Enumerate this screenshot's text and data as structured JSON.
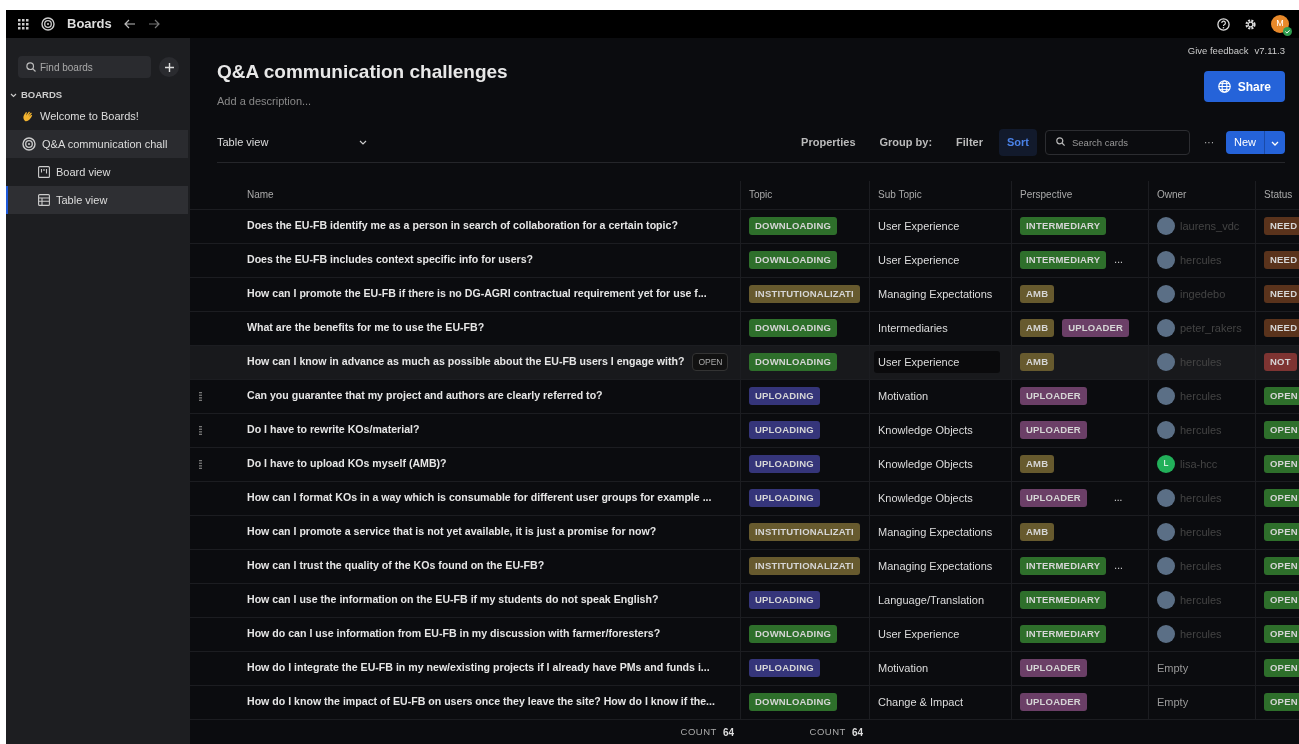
{
  "topbar": {
    "title": "Boards",
    "user_initial": "M"
  },
  "sidebar": {
    "search": {
      "placeholder": "Find boards"
    },
    "section": "BOARDS",
    "items": [
      {
        "label": "Welcome to Boards!",
        "selected": false
      },
      {
        "label": "Q&A communication chall",
        "selected": false,
        "children": [
          {
            "label": "Board view",
            "selected": false
          },
          {
            "label": "Table view",
            "selected": true
          }
        ]
      }
    ]
  },
  "header": {
    "feedback": "Give feedback",
    "version": "v7.11.3",
    "title": "Q&A communication challenges",
    "description_placeholder": "Add a description...",
    "share": "Share"
  },
  "toolbar": {
    "view": "Table view",
    "buttons": [
      {
        "label": "Properties",
        "active": false
      },
      {
        "label": "Group by:",
        "active": false
      },
      {
        "label": "Filter",
        "active": false
      },
      {
        "label": "Sort",
        "active": true
      }
    ],
    "search": {
      "placeholder": "Search cards"
    },
    "more": "···",
    "new": "New"
  },
  "table": {
    "columns": [
      "Name",
      "Topic",
      "Sub Topic",
      "Perspective",
      "Owner",
      "Status"
    ],
    "rows": [
      {
        "name": "Does the EU-FB identify me as a person in search of collaboration for a certain topic?",
        "hovered": false,
        "drag_handle": false,
        "topic": {
          "label": "DOWNLOADING",
          "color": "#2e6f2b"
        },
        "sub_topic": "User Experience",
        "perspective": [
          {
            "label": "INTERMEDIARY",
            "color": "#2e6f2b"
          }
        ],
        "owner": {
          "name": "laurens_vdc",
          "kind": "photo"
        },
        "status": {
          "label": "NEED",
          "color": "#5a331c"
        }
      },
      {
        "name": "Does the EU-FB includes context specific info for users?",
        "hovered": false,
        "drag_handle": false,
        "topic": {
          "label": "DOWNLOADING",
          "color": "#2e6f2b"
        },
        "sub_topic": "User Experience",
        "perspective": [
          {
            "label": "INTERMEDIARY",
            "color": "#2e6f2b"
          }
        ],
        "perspective_more": "...",
        "owner": {
          "name": "hercules",
          "kind": "photo"
        },
        "status": {
          "label": "NEED",
          "color": "#5a331c"
        }
      },
      {
        "name": "How can I promote the EU-FB if there is no DG-AGRI contractual requirement yet for use f...",
        "hovered": false,
        "drag_handle": false,
        "topic": {
          "label": "INSTITUTIONALIZATI",
          "color": "#675a2e"
        },
        "sub_topic": "Managing Expectations",
        "perspective": [
          {
            "label": "AMB",
            "color": "#675a2e"
          }
        ],
        "owner": {
          "name": "ingedebo",
          "kind": "photo"
        },
        "status": {
          "label": "NEED",
          "color": "#5a331c"
        }
      },
      {
        "name": "What are the benefits for me to use the EU-FB?",
        "hovered": false,
        "drag_handle": false,
        "topic": {
          "label": "DOWNLOADING",
          "color": "#2e6f2b"
        },
        "sub_topic": "Intermediaries",
        "perspective": [
          {
            "label": "AMB",
            "color": "#675a2e"
          },
          {
            "label": "UPLOADER",
            "color": "#6b3f67"
          }
        ],
        "owner": {
          "name": "peter_rakers",
          "kind": "photo"
        },
        "status": {
          "label": "NEED",
          "color": "#5a331c"
        }
      },
      {
        "name": "How can I know in advance as much as possible about the EU-FB users I engage with?",
        "hovered": true,
        "open_button": "OPEN",
        "drag_handle": false,
        "topic": {
          "label": "DOWNLOADING",
          "color": "#2e6f2b"
        },
        "sub_topic": "User Experience",
        "perspective": [
          {
            "label": "AMB",
            "color": "#675a2e"
          }
        ],
        "owner": {
          "name": "hercules",
          "kind": "photo"
        },
        "status": {
          "label": "NOT",
          "color": "#7e3432"
        }
      },
      {
        "name": "Can you guarantee that my project and authors are clearly referred to?",
        "hovered": false,
        "drag_handle": true,
        "topic": {
          "label": "UPLOADING",
          "color": "#35357a"
        },
        "sub_topic": "Motivation",
        "perspective": [
          {
            "label": "UPLOADER",
            "color": "#6b3f67"
          }
        ],
        "owner": {
          "name": "hercules",
          "kind": "photo"
        },
        "status": {
          "label": "OPEN",
          "color": "#2e6f2b"
        }
      },
      {
        "name": "Do I have to rewrite KOs/material?",
        "hovered": false,
        "drag_handle": true,
        "topic": {
          "label": "UPLOADING",
          "color": "#35357a"
        },
        "sub_topic": "Knowledge Objects",
        "perspective": [
          {
            "label": "UPLOADER",
            "color": "#6b3f67"
          }
        ],
        "owner": {
          "name": "hercules",
          "kind": "photo"
        },
        "status": {
          "label": "OPEN",
          "color": "#2e6f2b"
        }
      },
      {
        "name": "Do I have to upload KOs myself (AMB)?",
        "hovered": false,
        "drag_handle": true,
        "topic": {
          "label": "UPLOADING",
          "color": "#35357a"
        },
        "sub_topic": "Knowledge Objects",
        "perspective": [
          {
            "label": "AMB",
            "color": "#675a2e"
          }
        ],
        "owner": {
          "name": "lisa-hcc",
          "kind": "letter",
          "initial": "L"
        },
        "status": {
          "label": "OPEN",
          "color": "#2e6f2b"
        }
      },
      {
        "name": "How can I format KOs in a way which is consumable for different user groups for example ...",
        "hovered": false,
        "drag_handle": false,
        "topic": {
          "label": "UPLOADING",
          "color": "#35357a"
        },
        "sub_topic": "Knowledge Objects",
        "perspective": [
          {
            "label": "UPLOADER",
            "color": "#6b3f67"
          }
        ],
        "perspective_more": "...",
        "owner": {
          "name": "hercules",
          "kind": "photo"
        },
        "status": {
          "label": "OPEN",
          "color": "#2e6f2b"
        }
      },
      {
        "name": "How can I promote a service that is not yet available, it is just a promise for now?",
        "hovered": false,
        "drag_handle": false,
        "topic": {
          "label": "INSTITUTIONALIZATI",
          "color": "#675a2e"
        },
        "sub_topic": "Managing Expectations",
        "perspective": [
          {
            "label": "AMB",
            "color": "#675a2e"
          }
        ],
        "owner": {
          "name": "hercules",
          "kind": "photo"
        },
        "status": {
          "label": "OPEN",
          "color": "#2e6f2b"
        }
      },
      {
        "name": "How can I trust the quality of the KOs found on the EU-FB?",
        "hovered": false,
        "drag_handle": false,
        "topic": {
          "label": "INSTITUTIONALIZATI",
          "color": "#675a2e"
        },
        "sub_topic": "Managing Expectations",
        "perspective": [
          {
            "label": "INTERMEDIARY",
            "color": "#2e6f2b"
          }
        ],
        "perspective_more": "...",
        "owner": {
          "name": "hercules",
          "kind": "photo"
        },
        "status": {
          "label": "OPEN",
          "color": "#2e6f2b"
        }
      },
      {
        "name": "How can I use the information on the  EU-FB if my students do not speak English?",
        "hovered": false,
        "drag_handle": false,
        "topic": {
          "label": "UPLOADING",
          "color": "#35357a"
        },
        "sub_topic": "Language/Translation",
        "perspective": [
          {
            "label": "INTERMEDIARY",
            "color": "#2e6f2b"
          }
        ],
        "owner": {
          "name": "hercules",
          "kind": "photo"
        },
        "status": {
          "label": "OPEN",
          "color": "#2e6f2b"
        }
      },
      {
        "name": "How do can I use information from EU-FB in my discussion with farmer/foresters?",
        "hovered": false,
        "drag_handle": false,
        "topic": {
          "label": "DOWNLOADING",
          "color": "#2e6f2b"
        },
        "sub_topic": "User Experience",
        "perspective": [
          {
            "label": "INTERMEDIARY",
            "color": "#2e6f2b"
          }
        ],
        "owner": {
          "name": "hercules",
          "kind": "photo"
        },
        "status": {
          "label": "OPEN",
          "color": "#2e6f2b"
        }
      },
      {
        "name": "How do I integrate the EU-FB in my new/existing projects if I already have PMs and funds i...",
        "hovered": false,
        "drag_handle": false,
        "topic": {
          "label": "UPLOADING",
          "color": "#35357a"
        },
        "sub_topic": "Motivation",
        "perspective": [
          {
            "label": "UPLOADER",
            "color": "#6b3f67"
          }
        ],
        "owner": {
          "name": "Empty",
          "kind": "empty"
        },
        "status": {
          "label": "OPEN",
          "color": "#2e6f2b"
        }
      },
      {
        "name": "How do I know the impact of EU-FB on users once they leave the site? How do I know if the...",
        "hovered": false,
        "drag_handle": false,
        "topic": {
          "label": "DOWNLOADING",
          "color": "#2e6f2b"
        },
        "sub_topic": "Change & Impact",
        "perspective": [
          {
            "label": "UPLOADER",
            "color": "#6b3f67"
          }
        ],
        "owner": {
          "name": "Empty",
          "kind": "empty"
        },
        "status": {
          "label": "OPEN",
          "color": "#2e6f2b"
        }
      }
    ],
    "footer": [
      {
        "label": "COUNT",
        "value": "64"
      },
      {
        "label": "COUNT",
        "value": "64"
      }
    ]
  }
}
